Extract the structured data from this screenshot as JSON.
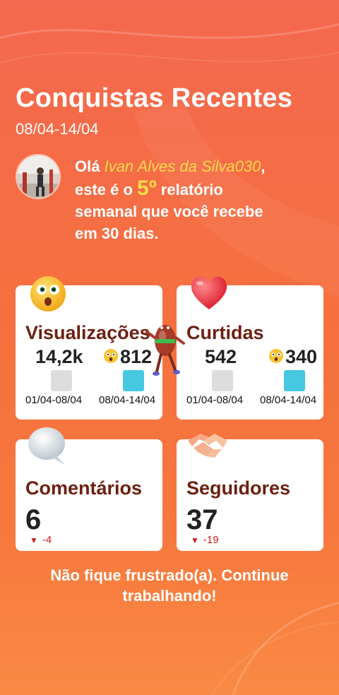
{
  "header": {
    "title": "Conquistas Recentes",
    "date_range": "08/04-14/04"
  },
  "greeting": {
    "hello": "Olá ",
    "username": "Ivan Alves da Silva030",
    "comma": ",",
    "line2_pre": "este é o ",
    "report_number": "5º",
    "line2_post": " relatório",
    "line3": "semanal que você recebe",
    "line4": "em 30 dias."
  },
  "cards": {
    "views": {
      "label": "Visualizações",
      "previous_value": "14,2k",
      "current_value": "812",
      "previous_period": "01/04-08/04",
      "current_period": "08/04-14/04"
    },
    "likes": {
      "label": "Curtidas",
      "previous_value": "542",
      "current_value": "340",
      "previous_period": "01/04-08/04",
      "current_period": "08/04-14/04"
    },
    "comments": {
      "label": "Comentários",
      "value": "6",
      "delta": "-4"
    },
    "followers": {
      "label": "Seguidores",
      "value": "37",
      "delta": "-19"
    }
  },
  "footer": {
    "message": "Não fique frustrado(a). Continue trabalhando!"
  },
  "icons": {
    "views_icon": "surprised-face-icon",
    "likes_icon": "heart-icon",
    "comments_icon": "speech-bubble-icon",
    "followers_icon": "handshake-icon",
    "value_emoji": "astonished-face-icon",
    "mascot": "dancing-bean-mascot-icon"
  },
  "colors": {
    "background": "#f6703f",
    "label": "#6e1f12",
    "highlight": "#ffd94a",
    "bar_previous": "#dddddd",
    "bar_current": "#45c8e0",
    "delta_negative": "#cc1c1c"
  }
}
